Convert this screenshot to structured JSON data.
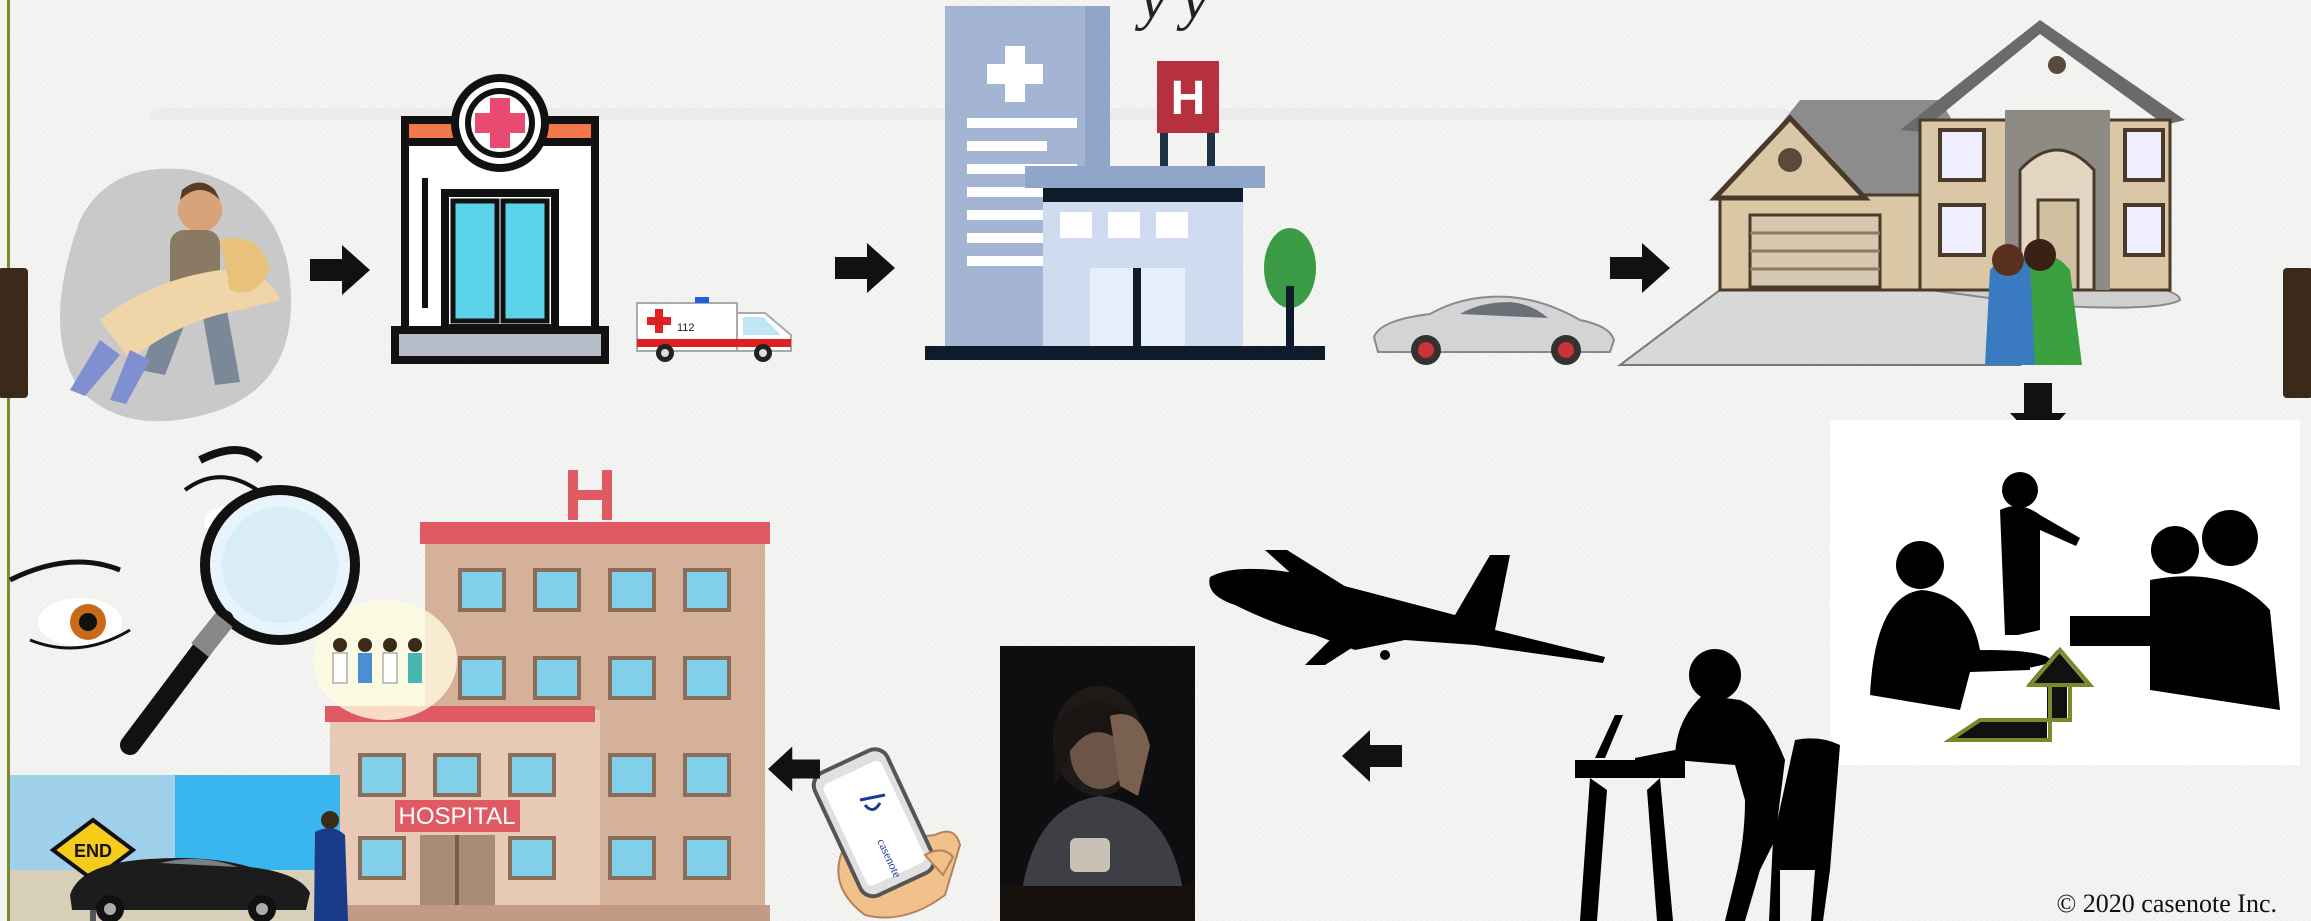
{
  "title": "y   y",
  "copyright": "© 2020 casenote Inc.",
  "icons": {
    "accident": "person-carrying-injured-person",
    "clinic": "clinic-building-icon",
    "ambulance": "ambulance-icon",
    "hospital_modern": "hospital-building-icon",
    "sports_car": "sports-car-icon",
    "house": "house-with-couple-icon",
    "meeting": "business-meeting-silhouette",
    "woman_desk": "woman-at-desk-silhouette",
    "airplane": "airplane-silhouette",
    "distressed": "distressed-person-photo",
    "phone": "phone-in-hand-icon",
    "hospital_big": "hospital-building-with-staff",
    "eye_magnifier": "eyes-magnifier-icon",
    "end_scene": "end-sign-car-woman"
  },
  "labels": {
    "ambulance_number": "112",
    "hospital_sign": "HOSPITAL",
    "h_sign": "H",
    "end_sign": "END",
    "phone_brand": "casenote"
  },
  "colors": {
    "arrow": "#111111",
    "hospital_red": "#e05a64",
    "clinic_cyan": "#5bd3e8",
    "modern_blue": "#8fa5c9",
    "corner_arrow_outline": "#7a8a2a"
  }
}
